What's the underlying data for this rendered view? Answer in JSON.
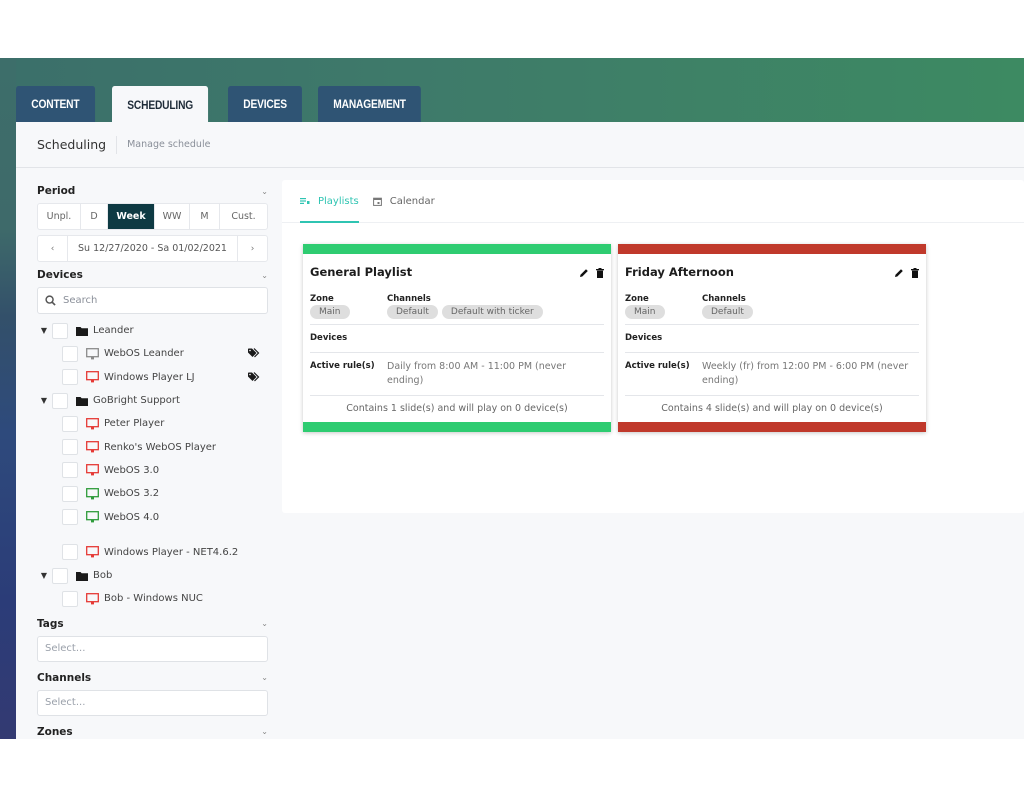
{
  "nav": {
    "tabs": [
      {
        "label": "CONTENT",
        "active": false
      },
      {
        "label": "SCHEDULING",
        "active": true
      },
      {
        "label": "DEVICES",
        "active": false
      },
      {
        "label": "MANAGEMENT",
        "active": false
      }
    ]
  },
  "header": {
    "title": "Scheduling",
    "subtitle": "Manage schedule"
  },
  "sidebar": {
    "period": {
      "label": "Period",
      "options": [
        "Unpl.",
        "D",
        "Week",
        "WW",
        "M",
        "Cust."
      ],
      "selected": "Week",
      "range": "Su 12/27/2020 - Sa 01/02/2021",
      "prev": "‹",
      "next": "›"
    },
    "devices": {
      "label": "Devices",
      "search_placeholder": "Search",
      "tree": [
        {
          "type": "group",
          "label": "Leander"
        },
        {
          "type": "device",
          "label": "WebOS Leander",
          "status": "gray",
          "tagged": true
        },
        {
          "type": "device",
          "label": "Windows Player LJ",
          "status": "red",
          "tagged": true
        },
        {
          "type": "group",
          "label": "GoBright Support"
        },
        {
          "type": "device",
          "label": "Peter Player",
          "status": "red"
        },
        {
          "type": "device",
          "label": "Renko's WebOS Player",
          "status": "red"
        },
        {
          "type": "device",
          "label": "WebOS 3.0",
          "status": "red"
        },
        {
          "type": "device",
          "label": "WebOS 3.2",
          "status": "green"
        },
        {
          "type": "device",
          "label": "WebOS 4.0",
          "status": "green"
        },
        {
          "type": "device",
          "label": "Windows Player - NET4.6.2",
          "status": "red"
        },
        {
          "type": "group",
          "label": "Bob"
        },
        {
          "type": "device",
          "label": "Bob - Windows NUC",
          "status": "red"
        }
      ]
    },
    "tags": {
      "label": "Tags",
      "placeholder": "Select..."
    },
    "channels": {
      "label": "Channels",
      "placeholder": "Select..."
    },
    "zones": {
      "label": "Zones"
    }
  },
  "content": {
    "tabs": [
      {
        "label": "Playlists",
        "icon": "playlist-icon",
        "active": true
      },
      {
        "label": "Calendar",
        "icon": "calendar-icon",
        "active": false
      }
    ],
    "playlists": [
      {
        "name": "General Playlist",
        "color": "#2ecc71",
        "zone_label": "Zone",
        "zone": "Main",
        "channels_label": "Channels",
        "channels": [
          "Default",
          "Default with ticker"
        ],
        "devices_label": "Devices",
        "rule_label": "Active rule(s)",
        "rule": "Daily from 8:00 AM - 11:00 PM (never ending)",
        "summary": "Contains 1 slide(s) and will play on 0 device(s)"
      },
      {
        "name": "Friday Afternoon",
        "color": "#c0392b",
        "zone_label": "Zone",
        "zone": "Main",
        "channels_label": "Channels",
        "channels": [
          "Default"
        ],
        "devices_label": "Devices",
        "rule_label": "Active rule(s)",
        "rule": "Weekly (fr) from 12:00 PM - 6:00 PM (never ending)",
        "summary": "Contains 4 slide(s) and will play on 0 device(s)"
      }
    ]
  },
  "colors": {
    "status_red": "#e53935",
    "status_green": "#2e9b3a",
    "status_gray": "#8a8a8a",
    "accent": "#2fc4b2",
    "period_active": "#0e3a43",
    "nav_tab": "#2f5474"
  }
}
